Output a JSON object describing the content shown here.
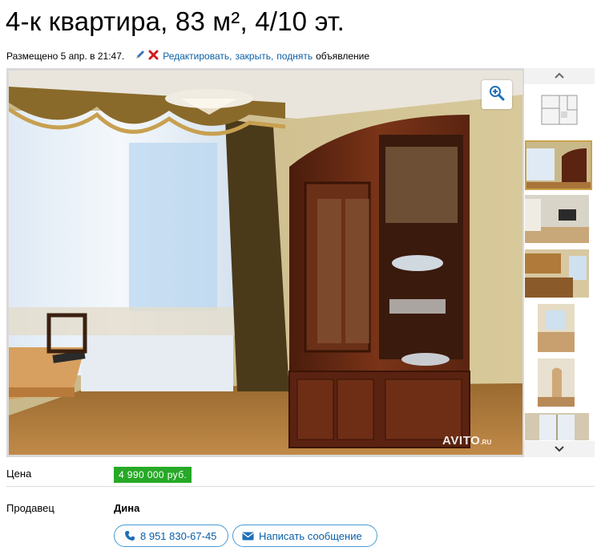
{
  "listing": {
    "title": "4-к квартира, 83 м², 4/10 эт.",
    "posted": "Размещено 5 апр. в 21:47.",
    "actions": {
      "edit": "Редактировать",
      "close": "закрыть",
      "raise": "поднять",
      "tail": "объявление",
      "separator": ","
    }
  },
  "gallery": {
    "watermark": "AVITO",
    "watermark_suffix": ".RU",
    "zoom_icon": "zoom-in-icon",
    "thumbnails": [
      {
        "alt": "floor-plan-thumbnail"
      },
      {
        "alt": "living-room-thumbnail",
        "selected": true
      },
      {
        "alt": "room-tv-thumbnail"
      },
      {
        "alt": "kitchen-thumbnail"
      },
      {
        "alt": "kitchen-window-thumbnail"
      },
      {
        "alt": "hallway-thumbnail"
      },
      {
        "alt": "window-thumbnail"
      }
    ]
  },
  "price": {
    "label": "Цена",
    "value": "4 990 000 руб."
  },
  "seller": {
    "label": "Продавец",
    "name": "Дина",
    "phone": "8 951 830-67-45",
    "message_button": "Написать сообщение"
  },
  "colors": {
    "link": "#0a5fa8",
    "price_bg": "#26a926",
    "button_border": "#4a9bd6"
  }
}
